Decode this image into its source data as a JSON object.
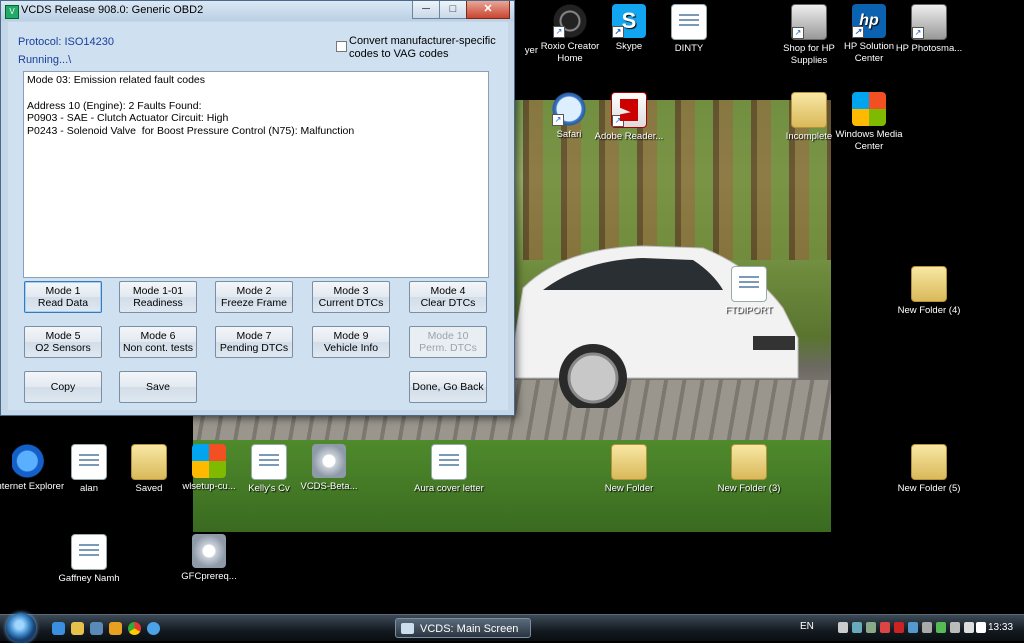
{
  "window": {
    "title": "VCDS Release 908.0:  Generic OBD2",
    "title_icon": "vcds-app-icon",
    "minimize": "─",
    "maximize": "□",
    "close": "✕"
  },
  "protocol": "Protocol: ISO14230",
  "running": "Running...\\",
  "convert_checkbox": {
    "checked": false,
    "label": "Convert manufacturer-specific codes to VAG codes"
  },
  "output_lines": [
    "Mode 03: Emission related fault codes",
    "",
    "Address 10 (Engine): 2 Faults Found:",
    "P0903 - SAE - Clutch Actuator Circuit: High",
    "P0243 - Solenoid Valve  for Boost Pressure Control (N75): Malfunction"
  ],
  "buttons": {
    "mode1": {
      "line1": "Mode 1",
      "line2": "Read Data"
    },
    "mode101": {
      "line1": "Mode 1-01",
      "line2": "Readiness"
    },
    "mode2": {
      "line1": "Mode 2",
      "line2": "Freeze Frame"
    },
    "mode3": {
      "line1": "Mode 3",
      "line2": "Current DTCs"
    },
    "mode4": {
      "line1": "Mode 4",
      "line2": "Clear DTCs"
    },
    "mode5": {
      "line1": "Mode 5",
      "line2": "O2 Sensors"
    },
    "mode6": {
      "line1": "Mode 6",
      "line2": "Non cont. tests"
    },
    "mode7": {
      "line1": "Mode 7",
      "line2": "Pending DTCs"
    },
    "mode9": {
      "line1": "Mode 9",
      "line2": "Vehicle Info"
    },
    "mode10": {
      "line1": "Mode 10",
      "line2": "Perm. DTCs"
    },
    "copy": "Copy",
    "save": "Save",
    "done": "Done, Go Back"
  },
  "desktop_icons": {
    "player": "yer",
    "roxio": "Roxio Creator Home",
    "skype": "Skype",
    "dinty": "DINTY",
    "shop_hp": "Shop for HP Supplies",
    "hp_solution": "HP Solution Center",
    "hp_photosmart": "HP Photosma...",
    "safari": "Safari",
    "adobe": "Adobe Reader...",
    "incomplete": "Incomplete",
    "wmc": "Windows Media Center",
    "ftdiport": "FTDIPORT",
    "new_folder_4": "New Folder (4)",
    "ie": "Internet Explorer",
    "alan": "alan",
    "saved": "Saved",
    "wlsetup": "wlsetup-cu...",
    "kellys_cv": "Kelly's Cv",
    "vcds_beta": "VCDS-Beta...",
    "aura": "Aura cover letter",
    "new_folder": "New Folder",
    "new_folder_3": "New Folder (3)",
    "new_folder_5": "New Folder (5)",
    "gaffney": "Gaffney Namh",
    "gfcprereq": "GFCprereq..."
  },
  "taskbar": {
    "active_task": "VCDS:  Main Screen",
    "language": "EN",
    "clock": "13:33"
  }
}
